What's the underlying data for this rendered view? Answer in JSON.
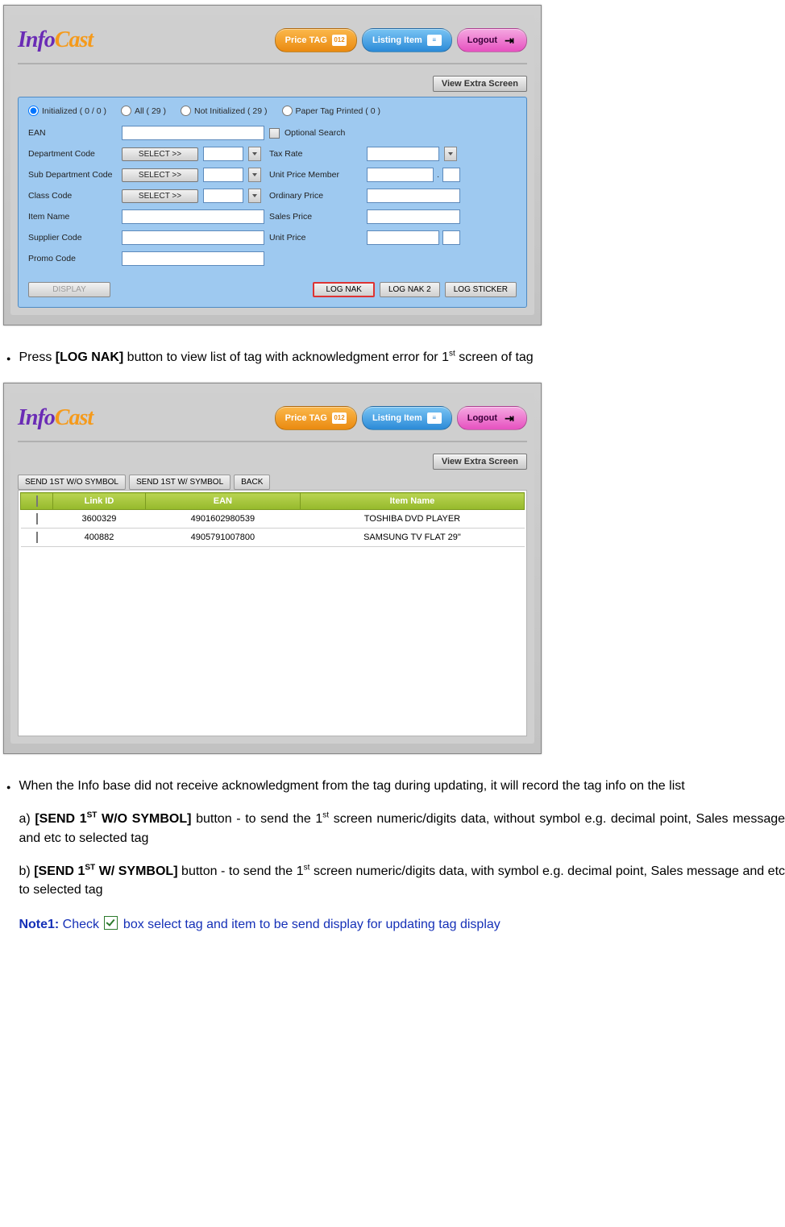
{
  "screenshot1": {
    "logo": "InfoCast",
    "buttons": {
      "priceTag": "Price TAG",
      "priceTagBadge": "012",
      "listing": "Listing Item",
      "logout": "Logout"
    },
    "viewExtra": "View Extra Screen",
    "radios": [
      {
        "label": "Initialized  ( 0 / 0 )",
        "checked": true
      },
      {
        "label": "All  ( 29 )",
        "checked": false
      },
      {
        "label": "Not Initialized  ( 29 )",
        "checked": false
      },
      {
        "label": "Paper Tag Printed  ( 0 )",
        "checked": false
      }
    ],
    "leftFields": {
      "ean": "EAN",
      "dept": "Department Code",
      "subDept": "Sub Department Code",
      "classCode": "Class Code",
      "itemName": "Item Name",
      "supplier": "Supplier Code",
      "promo": "Promo Code",
      "selectBtn": "SELECT >>"
    },
    "rightFields": {
      "optSearch": "Optional Search",
      "taxRate": "Tax Rate",
      "unitPriceMember": "Unit Price Member",
      "ordinaryPrice": "Ordinary Price",
      "salesPrice": "Sales Price",
      "unitPrice": "Unit Price"
    },
    "bottom": {
      "display": "DISPLAY",
      "logNak": "LOG NAK",
      "logNak2": "LOG NAK 2",
      "logSticker": "LOG STICKER"
    }
  },
  "docText1": {
    "bullet": "Press ",
    "bulletBold": "[LOG NAK]",
    "bulletAfter": " button to view list of tag with acknowledgment error for 1",
    "bulletSup": "st",
    "bulletEnd": " screen of tag"
  },
  "screenshot2": {
    "tabs": {
      "sendWo": "SEND 1ST W/O SYMBOL",
      "sendW": "SEND 1ST W/ SYMBOL",
      "back": "BACK"
    },
    "headers": {
      "chk": "",
      "link": "Link ID",
      "ean": "EAN",
      "item": "Item Name"
    },
    "rows": [
      {
        "link": "3600329",
        "ean": "4901602980539",
        "item": "TOSHIBA DVD PLAYER"
      },
      {
        "link": "400882",
        "ean": "4905791007800",
        "item": "SAMSUNG TV FLAT 29\""
      }
    ]
  },
  "docText2": {
    "bullet": "When the Info base did not receive acknowledgment from the tag during updating, it will record the tag info on the list",
    "aPrefix": "a) ",
    "aBold": "[SEND 1",
    "aSup": "ST",
    "aBold2": " W/O SYMBOL]",
    "aRest": " button - to send the 1",
    "aSup2": "st",
    "aRest2": " screen numeric/digits data, without symbol e.g. decimal point, Sales message and etc to selected tag",
    "bPrefix": "b) ",
    "bBold": "[SEND 1",
    "bSup": "ST",
    "bBold2": " W/ SYMBOL]",
    "bRest": " button - to send the 1",
    "bSup2": "st",
    "bRest2": " screen numeric/digits data, with symbol e.g. decimal point, Sales message and etc to selected tag",
    "noteLabel": "Note1:",
    "noteBefore": " Check ",
    "noteAfter": " box select tag and item to be send display for updating tag display"
  }
}
